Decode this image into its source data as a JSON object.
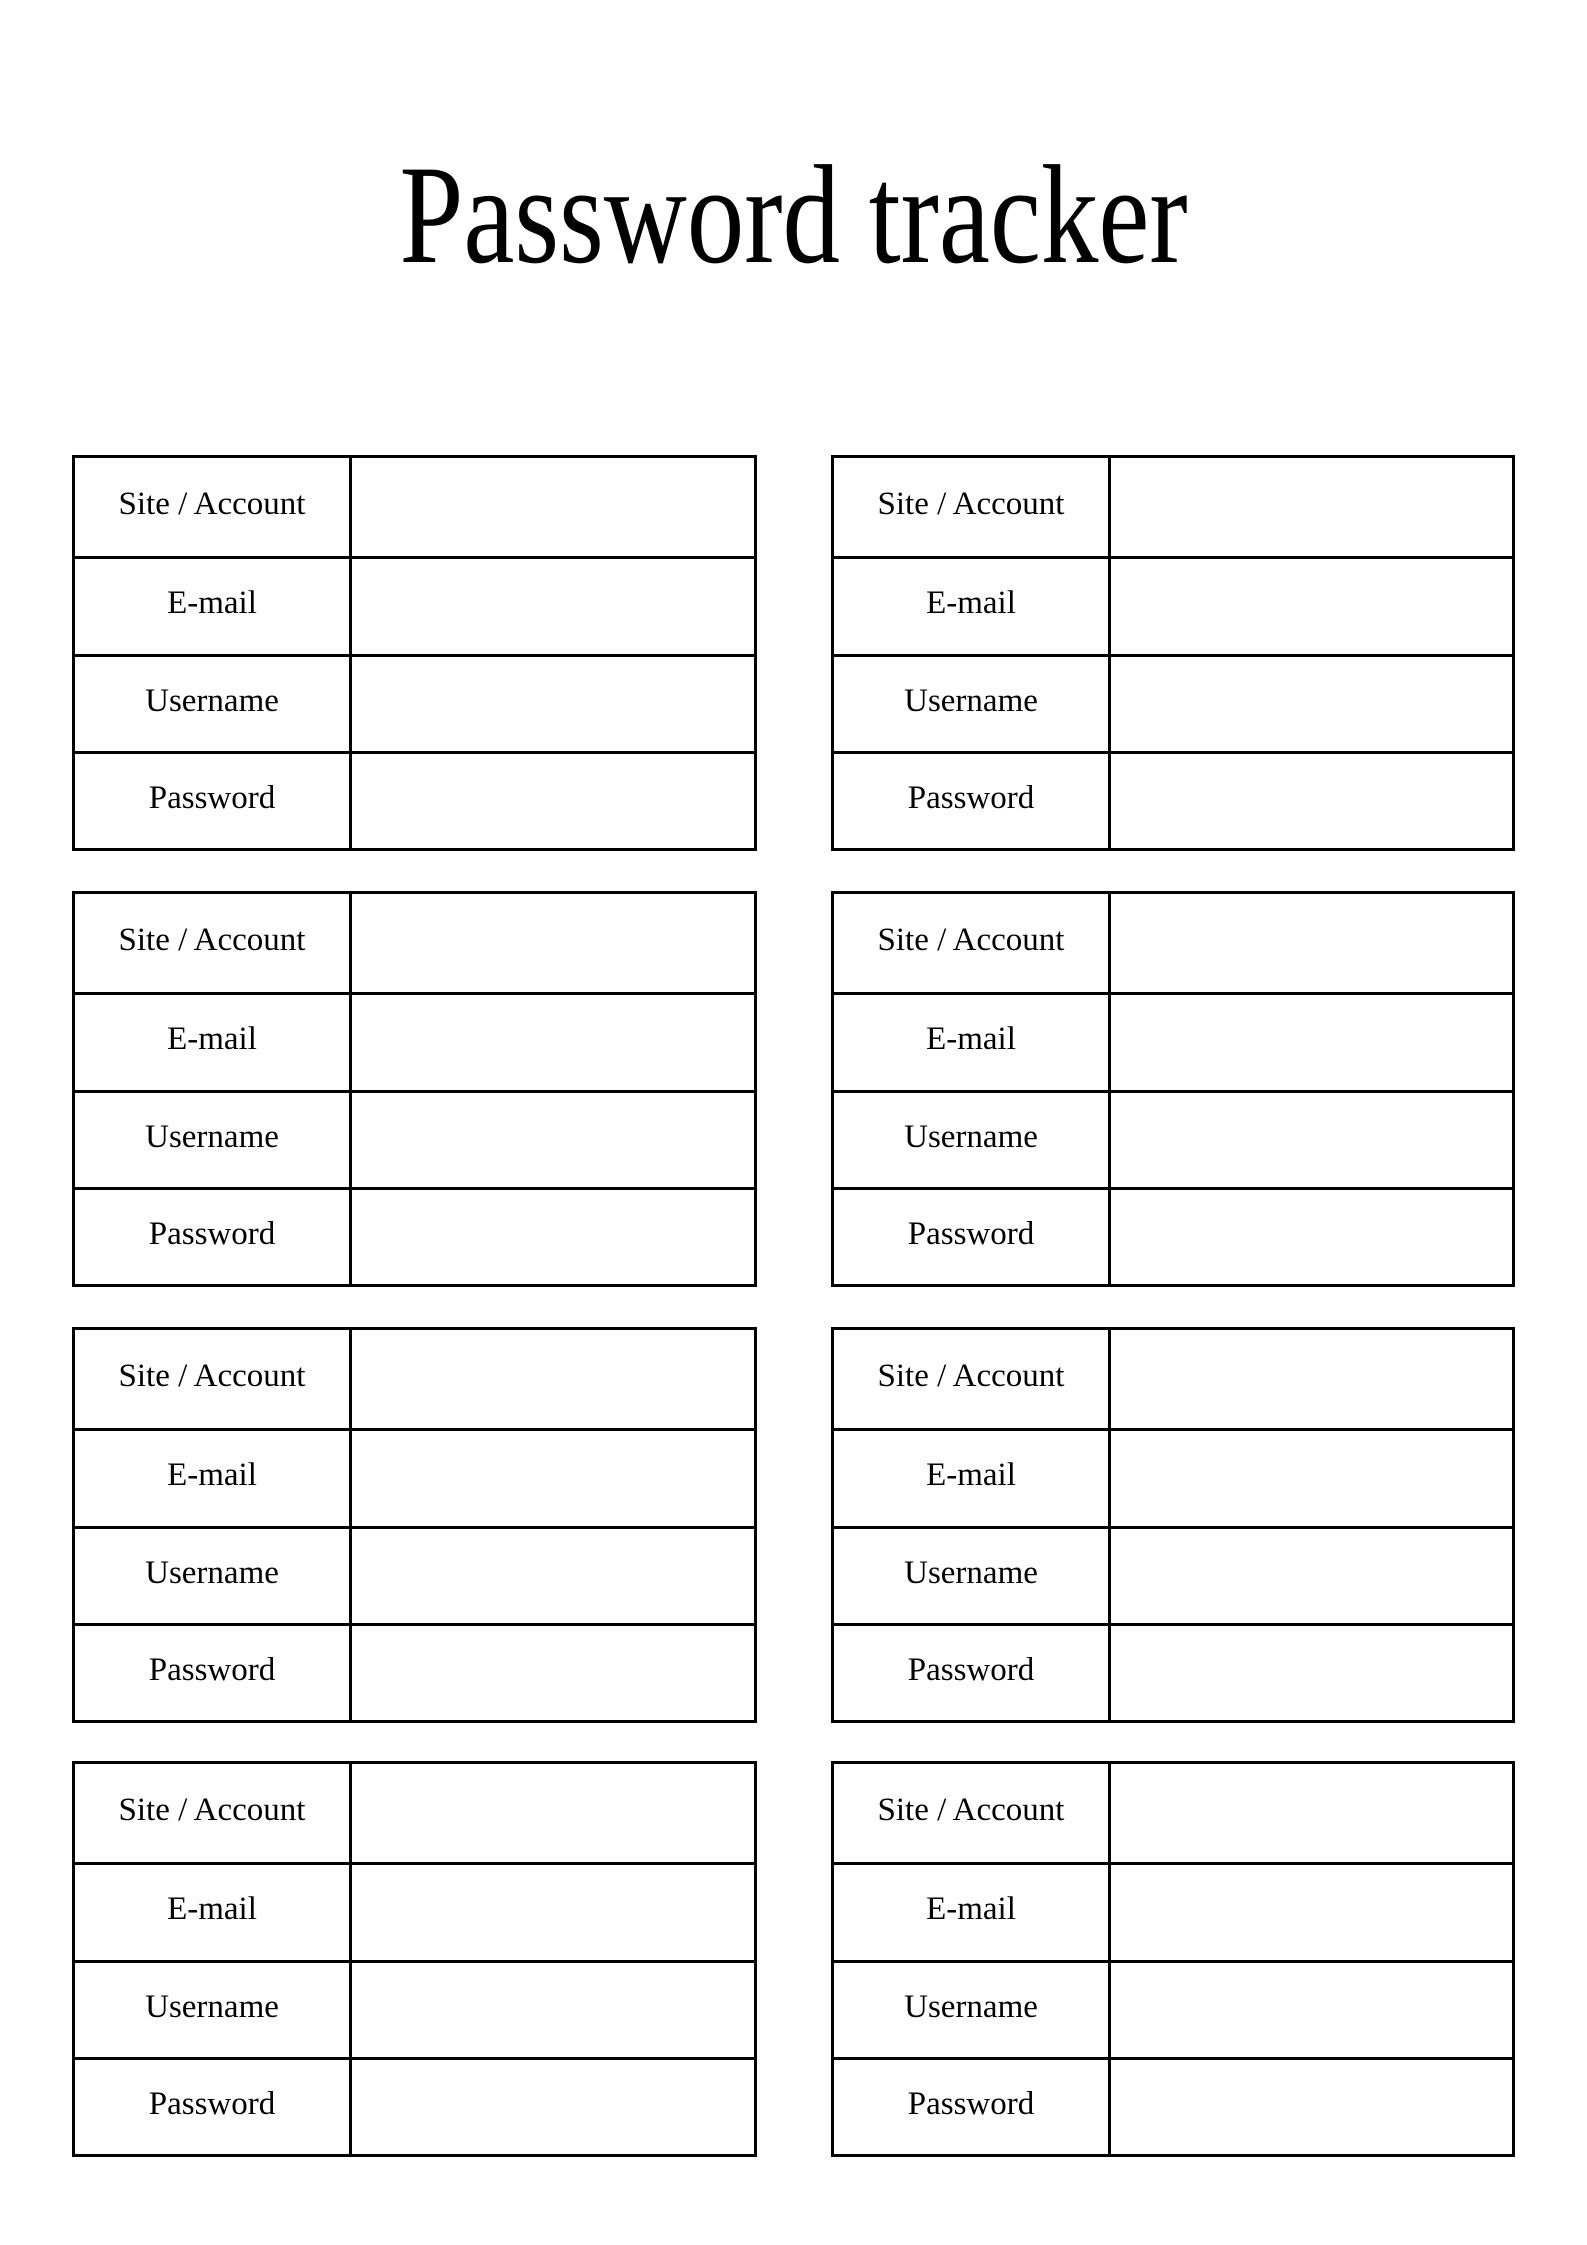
{
  "document": {
    "title": "Password tracker"
  },
  "field_labels": {
    "site": "Site / Account",
    "email": "E-mail",
    "username": "Username",
    "password": "Password"
  },
  "entries": [
    {
      "site": "",
      "email": "",
      "username": "",
      "password": ""
    },
    {
      "site": "",
      "email": "",
      "username": "",
      "password": ""
    },
    {
      "site": "",
      "email": "",
      "username": "",
      "password": ""
    },
    {
      "site": "",
      "email": "",
      "username": "",
      "password": ""
    },
    {
      "site": "",
      "email": "",
      "username": "",
      "password": ""
    },
    {
      "site": "",
      "email": "",
      "username": "",
      "password": ""
    },
    {
      "site": "",
      "email": "",
      "username": "",
      "password": ""
    },
    {
      "site": "",
      "email": "",
      "username": "",
      "password": ""
    }
  ],
  "colors": {
    "ink": "#000000",
    "paper": "#ffffff"
  }
}
